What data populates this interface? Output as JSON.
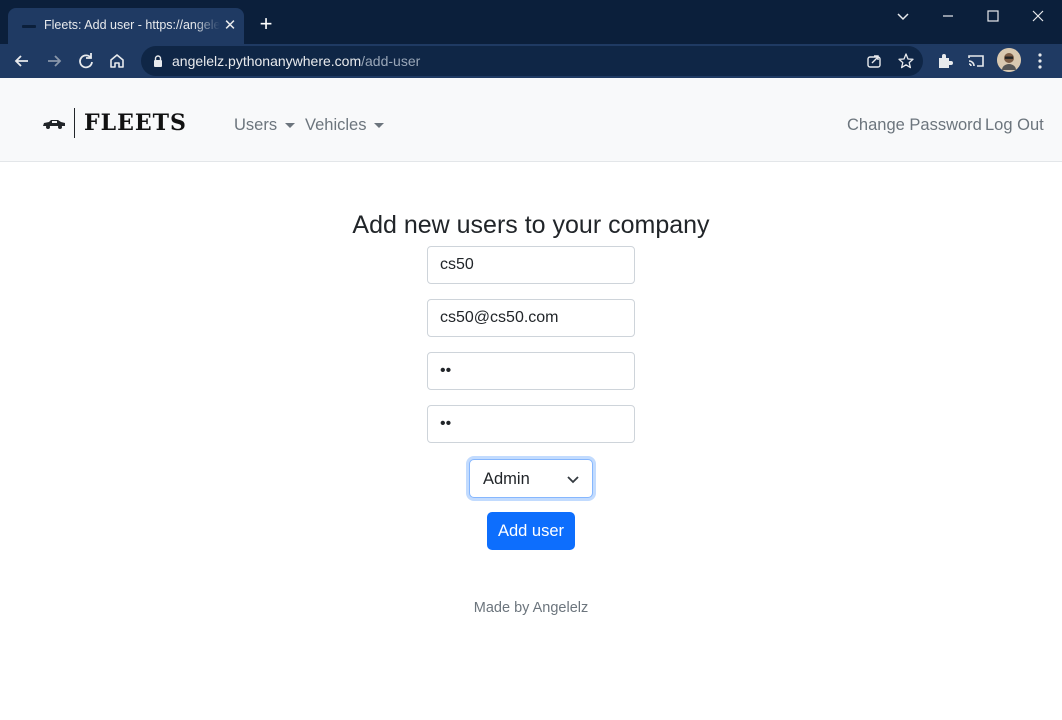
{
  "browser": {
    "tab_title": "Fleets: Add user - https://angelelz.pythonanywhere.com/add-user",
    "tab_close": "✕",
    "new_tab": "+",
    "url_host": "angelelz.pythonanywhere.com",
    "url_path": "/add-user"
  },
  "navbar": {
    "brand": "FLEETS",
    "menus": [
      {
        "label": "Users"
      },
      {
        "label": "Vehicles"
      }
    ],
    "right_links": [
      {
        "label": "Change Password"
      },
      {
        "label": "Log Out"
      }
    ]
  },
  "form": {
    "heading": "Add new users to your company",
    "username": "cs50",
    "email": "cs50@cs50.com",
    "password": "••",
    "confirm_password": "••",
    "role": "Admin",
    "submit_label": "Add user"
  },
  "footer": {
    "text": "Made by Angelelz"
  },
  "colors": {
    "titlebar": "#0b1f3b",
    "toolbar": "#1f3a63",
    "primary": "#0d6efd",
    "navbar_bg": "#f8f9fa",
    "muted_text": "#6c757d"
  },
  "icons": [
    "back-icon",
    "forward-icon",
    "reload-icon",
    "home-icon",
    "lock-icon",
    "share-icon",
    "star-icon",
    "extensions-icon",
    "cast-icon",
    "profile-avatar",
    "menu-dots-icon",
    "chevron-down-icon",
    "minimize-icon",
    "maximize-icon",
    "close-window-icon",
    "car-logo-icon"
  ]
}
